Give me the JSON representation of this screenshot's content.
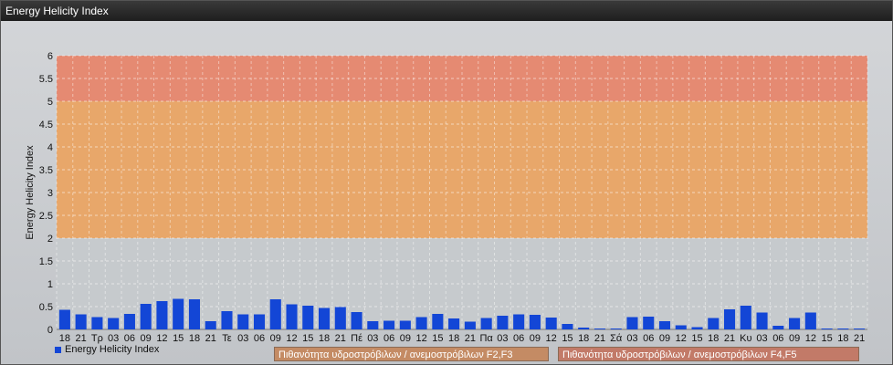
{
  "window": {
    "title": "Energy Helicity Index"
  },
  "chart_data": {
    "type": "bar",
    "ylabel": "Energy Helicity Index",
    "ylim": [
      0,
      6
    ],
    "yticks": [
      "0",
      "0.5",
      "1",
      "1.5",
      "2",
      "2.5",
      "3",
      "3.5",
      "4",
      "4.5",
      "5",
      "5.5",
      "6"
    ],
    "categories": [
      "18",
      "21",
      "Τρ",
      "03",
      "06",
      "09",
      "12",
      "15",
      "18",
      "21",
      "Τε",
      "03",
      "06",
      "09",
      "12",
      "15",
      "18",
      "21",
      "Πέ",
      "03",
      "06",
      "09",
      "12",
      "15",
      "18",
      "21",
      "Πα",
      "03",
      "06",
      "09",
      "12",
      "15",
      "18",
      "21",
      "Σά",
      "03",
      "06",
      "09",
      "12",
      "15",
      "18",
      "21",
      "Κυ",
      "03",
      "06",
      "09",
      "12",
      "15",
      "18",
      "21"
    ],
    "values": [
      0.43,
      0.33,
      0.27,
      0.25,
      0.34,
      0.56,
      0.62,
      0.67,
      0.66,
      0.18,
      0.4,
      0.33,
      0.33,
      0.66,
      0.55,
      0.52,
      0.47,
      0.49,
      0.38,
      0.18,
      0.19,
      0.19,
      0.27,
      0.34,
      0.24,
      0.17,
      0.25,
      0.3,
      0.33,
      0.32,
      0.26,
      0.12,
      0.04,
      0.02,
      0.02,
      0.27,
      0.28,
      0.18,
      0.09,
      0.05,
      0.25,
      0.44,
      0.52,
      0.37,
      0.08,
      0.25,
      0.37,
      0.02,
      0.02,
      0.02
    ],
    "series": [
      {
        "name": "Energy Helicity Index",
        "color": "#1346d6"
      }
    ],
    "bands": [
      {
        "from": 2,
        "to": 5,
        "label": "Πιθανότητα υδροστρόβιλων / ανεμοστρόβιλων F2,F3",
        "color": "#e8a76a"
      },
      {
        "from": 5,
        "to": 6,
        "label": "Πιθανότητα υδροστρόβιλων / ανεμοστρόβιλων F4,F5",
        "color": "#e58a72"
      }
    ],
    "legend_position": "bottom-left",
    "grid": true
  }
}
